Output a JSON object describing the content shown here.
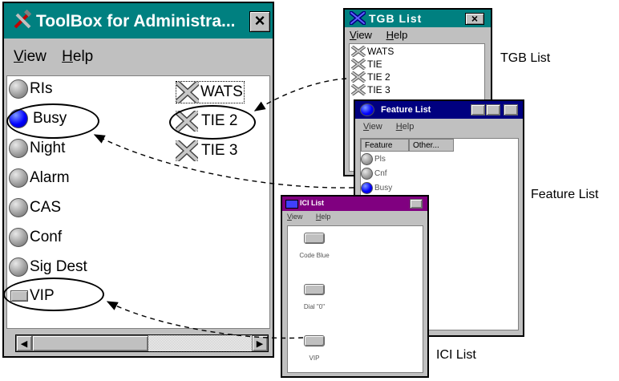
{
  "toolbox": {
    "title": "ToolBox for Administra...",
    "close": "×",
    "menu": [
      "View",
      "Help"
    ],
    "features": [
      {
        "label": "RIs",
        "state": "off"
      },
      {
        "label": "Busy",
        "state": "on"
      },
      {
        "label": "Night",
        "state": "off"
      },
      {
        "label": "Alarm",
        "state": "off"
      },
      {
        "label": "CAS",
        "state": "off"
      },
      {
        "label": "Conf",
        "state": "off"
      },
      {
        "label": "Sig Dest",
        "state": "off"
      }
    ],
    "ici": {
      "label": "VIP"
    },
    "trunks": [
      "WATS",
      "TIE 2",
      "TIE 3"
    ],
    "scroll_left": "◀",
    "scroll_right": "▶"
  },
  "tgb": {
    "title": "TGB List",
    "close": "×",
    "menu": [
      "View",
      "Help"
    ],
    "items": [
      "WATS",
      "TIE",
      "TIE 2",
      "TIE 3"
    ]
  },
  "feature_list": {
    "title": "Feature List",
    "menu": [
      "View",
      "Help"
    ],
    "columns": [
      "Feature",
      "Other..."
    ],
    "items": [
      {
        "label": "Pls",
        "state": "off"
      },
      {
        "label": "Cnf",
        "state": "off"
      },
      {
        "label": "Busy",
        "state": "on"
      }
    ]
  },
  "ici_list": {
    "title": "ICI List",
    "menu": [
      "View",
      "Help"
    ],
    "buttons": [
      "Code Blue",
      "Dial \"0\"",
      "VIP"
    ]
  },
  "captions": {
    "tgb": "TGB List",
    "feature": "Feature List",
    "ici": "ICI List"
  },
  "colors": {
    "titlebar": "#008080",
    "ici_titlebar": "#800080",
    "feature_titlebar": "#000080",
    "window_face": "#c0c0c0",
    "active_led": "#0000ff"
  }
}
